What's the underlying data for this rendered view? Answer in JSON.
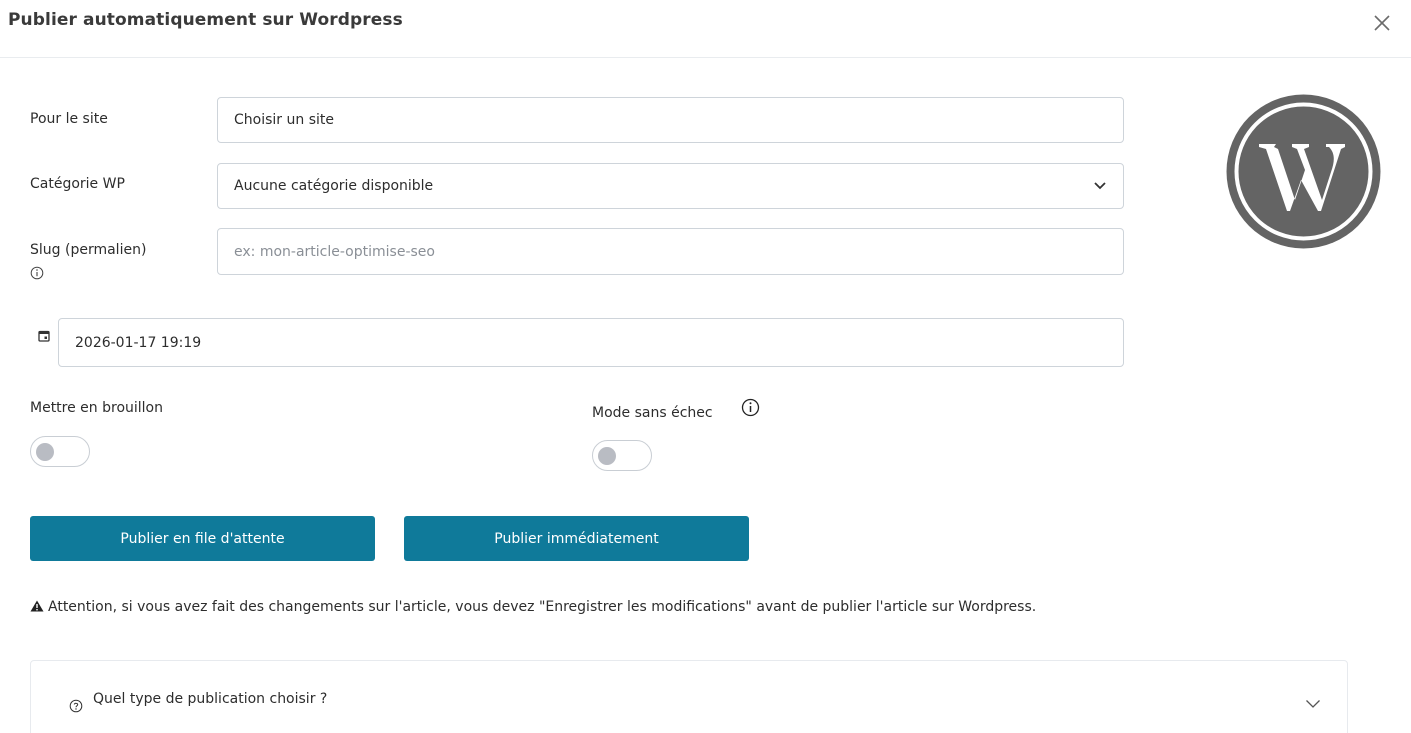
{
  "modal": {
    "title": "Publier automatiquement sur Wordpress"
  },
  "form": {
    "site_label": "Pour le site",
    "site_value": "Choisir un site",
    "category_label": "Catégorie WP",
    "category_selected": "Aucune catégorie disponible",
    "slug_label": "Slug (permalien)",
    "slug_placeholder": "ex: mon-article-optimise-seo",
    "date_value": "2026-01-17 19:19"
  },
  "toggles": {
    "draft_label": "Mettre en brouillon",
    "draft_on": false,
    "safe_mode_label": "Mode sans échec",
    "safe_mode_on": false
  },
  "buttons": {
    "queue_label": "Publier en file d'attente",
    "now_label": "Publier immédiatement"
  },
  "warning": {
    "text": "Attention, si vous avez fait des changements sur l'article, vous devez \"Enregistrer les modifications\" avant de publier l'article sur Wordpress."
  },
  "accordion": {
    "title": "Quel type de publication choisir ?"
  },
  "colors": {
    "primary_button": "#0f7a9a",
    "wp_logo": "#646464",
    "border": "#ced4da"
  },
  "icons": [
    "close-icon",
    "chevron-down-icon",
    "info-icon",
    "calendar-icon",
    "wordpress-logo",
    "warning-icon",
    "question-icon"
  ]
}
